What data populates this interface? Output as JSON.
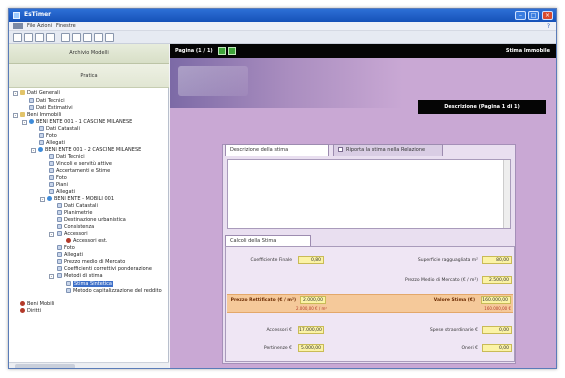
{
  "window": {
    "title": "EsTimer"
  },
  "menubar": {
    "items": [
      "File",
      "Azioni",
      "Finestre"
    ],
    "help_label": "?"
  },
  "sidebar": {
    "header_label": "Archivio Modelli",
    "sub_label": "Pratica",
    "tree": [
      {
        "label": "Dati Generali",
        "icon": "folder-icon"
      },
      {
        "label": "Dati Tecnici",
        "icon": "doc-icon"
      },
      {
        "label": "Dati Estimativi",
        "icon": "doc-icon"
      },
      {
        "label": "Beni Immobili",
        "icon": "folder-icon"
      },
      {
        "label": "BENI ENTE 001 - 1 CASCINE MILANESE",
        "icon": "globe-icon"
      },
      {
        "label": "Dati Catastali",
        "icon": "doc-icon"
      },
      {
        "label": "Foto",
        "icon": "doc-icon"
      },
      {
        "label": "Allegati",
        "icon": "doc-icon"
      },
      {
        "label": "BENI ENTE 001 - 2 CASCINE MILANESE",
        "icon": "globe-icon"
      },
      {
        "label": "Dati Tecnici",
        "icon": "doc-icon"
      },
      {
        "label": "Vincoli e servitù attive",
        "icon": "doc-icon"
      },
      {
        "label": "Accertamenti e Stime",
        "icon": "doc-icon"
      },
      {
        "label": "Foto",
        "icon": "doc-icon"
      },
      {
        "label": "Piani",
        "icon": "doc-icon"
      },
      {
        "label": "Allegati",
        "icon": "doc-icon"
      },
      {
        "label": "BENI ENTE - MOBILI 001",
        "icon": "globe-icon"
      },
      {
        "label": "Dati Catastali",
        "icon": "doc-icon"
      },
      {
        "label": "Planimetrie",
        "icon": "doc-icon"
      },
      {
        "label": "Destinazione urbanistica",
        "icon": "doc-icon"
      },
      {
        "label": "Consistenza",
        "icon": "doc-icon"
      },
      {
        "label": "Accessori",
        "icon": "doc-icon"
      },
      {
        "label": "Accessori est.",
        "icon": "bullet-icon"
      },
      {
        "label": "Foto",
        "icon": "doc-icon"
      },
      {
        "label": "Allegati",
        "icon": "doc-icon"
      },
      {
        "label": "Prezzo medio di Mercato",
        "icon": "doc-icon"
      },
      {
        "label": "Coefficienti correttivi ponderazione",
        "icon": "doc-icon"
      },
      {
        "label": "Metodi di stima",
        "icon": "doc-icon"
      },
      {
        "label": "Stima Sintetica",
        "icon": "doc-icon",
        "selected": true
      },
      {
        "label": "Metodo capitalizzazione del reddito",
        "icon": "doc-icon"
      },
      {
        "label": "Beni Mobili",
        "icon": "bullet-icon"
      },
      {
        "label": "Diritti",
        "icon": "bullet-icon"
      }
    ]
  },
  "content": {
    "page_label": "Pagina (1 / 1)",
    "header_title": "Stima Immobile",
    "desc_bar": "Descrizione (Pagina 1 di 1)",
    "tabs": {
      "description": "Descrizione della stima",
      "show_checkbox": "Riporta la stima nella Relazione"
    },
    "calc_tab": "Calcoli della Stima",
    "fields": {
      "coefficiente_label": "Coefficiente Finale",
      "coefficiente_value": "0,80",
      "superficie_label": "Superficie ragguagliata m²",
      "superficie_value": "80,00",
      "prezzo_medio_label": "Prezzo Medio di Mercato (€ / m²)",
      "prezzo_medio_value": "2.500,00",
      "prezzo_rettificato_label": "Prezzo Rettificato (€ / m²)",
      "prezzo_rettificato_value": "2.000,00",
      "prezzo_rettificato_sub": "2.000,00 € / m²",
      "valore_label": "Valore Stima (€)",
      "valore_value": "160.000,00",
      "valore_sub": "160.000,00 €",
      "accessori_label": "Accessori €",
      "accessori_value": "17.000,00",
      "spese_label": "Spese straordinarie €",
      "spese_value": "0,00",
      "pertinenze_label": "Pertinenze €",
      "pertinenze_value": "5.000,00",
      "oneri_label": "Oneri €",
      "oneri_value": "0,00"
    }
  },
  "colors": {
    "titlebar": "#1f5fc8",
    "content_bg": "#c9a8d4",
    "highlight_row": "#f5c99a",
    "field_bg": "#fbf3a6",
    "nav_button": "#3fa43a"
  }
}
